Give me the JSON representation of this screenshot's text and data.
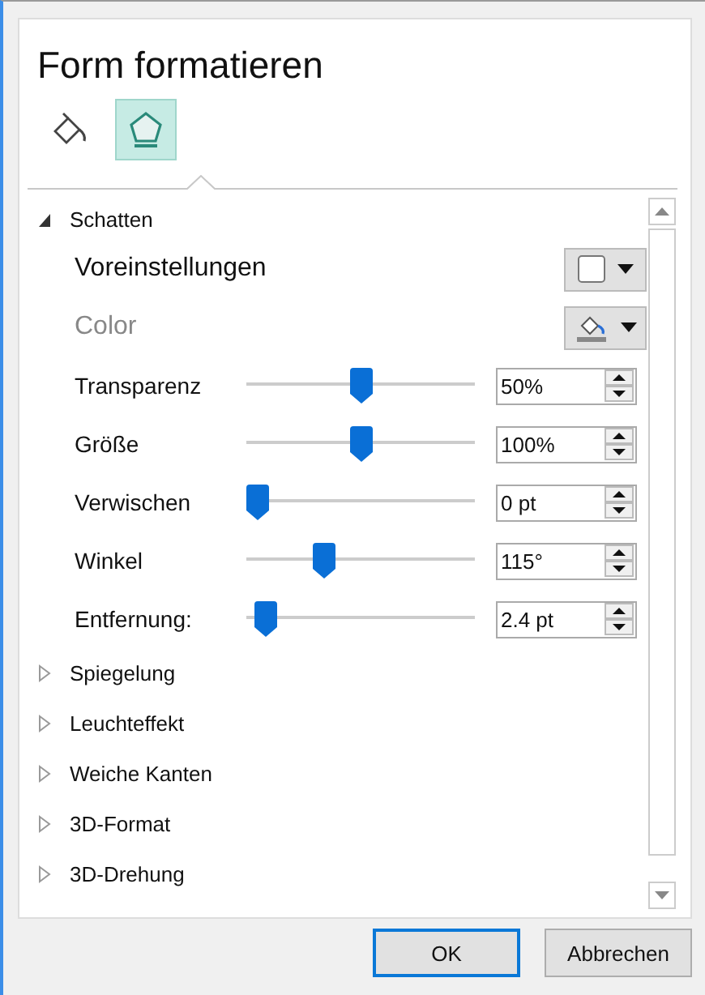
{
  "title": "Form formatieren",
  "tabs": [
    {
      "selected": false
    },
    {
      "selected": true
    }
  ],
  "sections": [
    {
      "label": "Schatten",
      "expanded": true,
      "controls": [
        {
          "kind": "preset",
          "label": "Voreinstellungen",
          "disabled": false
        },
        {
          "kind": "color",
          "label": "Color",
          "disabled": true
        },
        {
          "kind": "slider",
          "label": "Transparenz",
          "level": 0.5,
          "value": "50%"
        },
        {
          "kind": "slider",
          "label": "Größe",
          "level": 0.5,
          "value": "100%"
        },
        {
          "kind": "slider",
          "label": "Verwischen",
          "level": 0,
          "value": "0 pt"
        },
        {
          "kind": "slider",
          "label": "Winkel",
          "level": 0.32,
          "value": "115°"
        },
        {
          "kind": "slider",
          "label": "Entfernung:",
          "level": 0.04,
          "value": "2.4 pt"
        }
      ]
    },
    {
      "label": "Spiegelung",
      "expanded": false
    },
    {
      "label": "Leuchteffekt",
      "expanded": false
    },
    {
      "label": "Weiche Kanten",
      "expanded": false
    },
    {
      "label": "3D-Format",
      "expanded": false
    },
    {
      "label": "3D-Drehung",
      "expanded": false
    }
  ],
  "buttons": [
    {
      "label": "OK",
      "selected": true
    },
    {
      "label": "Abbrechen",
      "selected": false
    }
  ]
}
